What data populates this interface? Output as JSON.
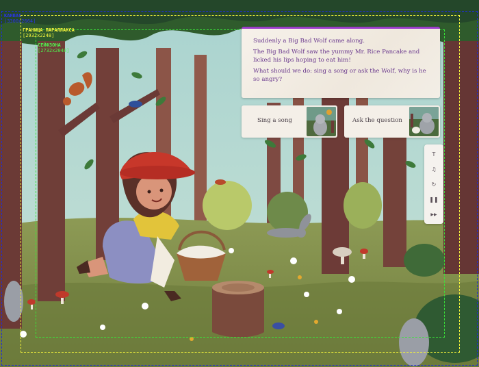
{
  "guides": {
    "canvas": {
      "label": "КАНВАС",
      "size": "[3300x2664]",
      "color": "#1f2bd6"
    },
    "parallax": {
      "label": "ГРАНИЦА ПАРАЛЛАКСА",
      "size": "[2932x2248]",
      "color": "#f2f23a"
    },
    "safezone": {
      "label": "СЕЙФЗОНА",
      "size": "[2732x2048]",
      "color": "#39e639"
    }
  },
  "story": {
    "accent_color": "#9b3cc9",
    "lines": [
      "Suddenly a Big Bad Wolf came along.",
      "The Big Bad Wolf saw the yummy Mr. Rice Pancake and licked his lips hoping to eat him!",
      "What should we do: sing a song or ask the Wolf, why is he so angry?"
    ]
  },
  "choices": [
    {
      "label": "Sing a song",
      "thumb_icon": "wolf-singing-thumbnail"
    },
    {
      "label": "Ask the question",
      "thumb_icon": "wolf-question-thumbnail"
    }
  ],
  "toolbar": {
    "tools": [
      {
        "icon": "text-size-icon",
        "glyph": "T"
      },
      {
        "icon": "music-note-icon",
        "glyph": "♫"
      },
      {
        "icon": "restart-icon",
        "glyph": "↻"
      },
      {
        "icon": "pause-icon",
        "glyph": "❚❚"
      },
      {
        "icon": "fast-forward-icon",
        "glyph": "▶▶"
      }
    ]
  }
}
